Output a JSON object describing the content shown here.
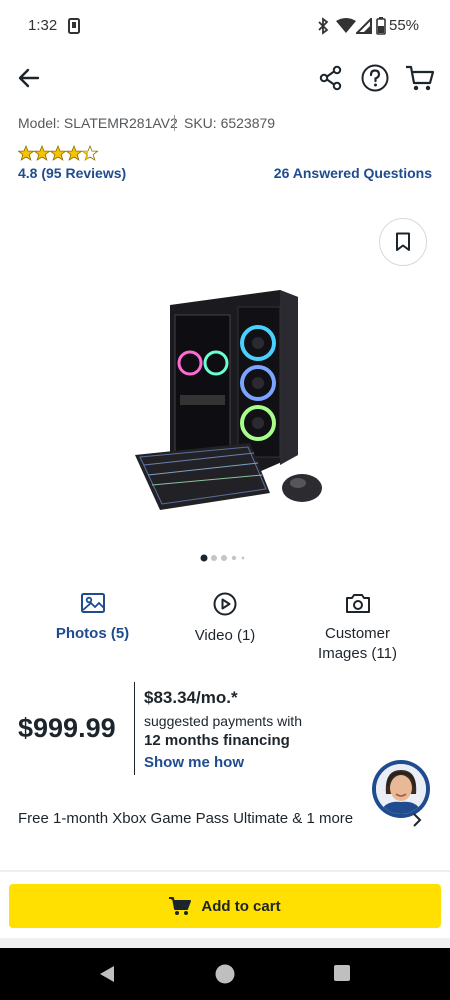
{
  "status_bar": {
    "time": "1:32",
    "battery": "55%"
  },
  "header": {
    "model": "Model: SLATEMR281AV2",
    "sku": "SKU: 6523879"
  },
  "rating": {
    "stars": 4.8,
    "text": "4.8 (95 Reviews)",
    "answered": "26 Answered Questions"
  },
  "carousel": {
    "total": 5,
    "active": 1
  },
  "media_tabs": [
    {
      "label": "Photos (5)"
    },
    {
      "label": "Video (1)"
    },
    {
      "label": "Customer\nImages (11)"
    }
  ],
  "pricing": {
    "price": "$999.99",
    "monthly": "$83.34/mo.*",
    "suggested": "suggested payments with",
    "financing": "12 months financing",
    "show_me_how": "Show me how"
  },
  "promo": {
    "text": "Free 1-month Xbox Game Pass Ultimate & 1 more"
  },
  "cart": {
    "label": "Add to cart"
  },
  "colors": {
    "accent_blue": "#1f4c8f",
    "cart_yellow": "#ffe000",
    "star": "#f7c300"
  }
}
